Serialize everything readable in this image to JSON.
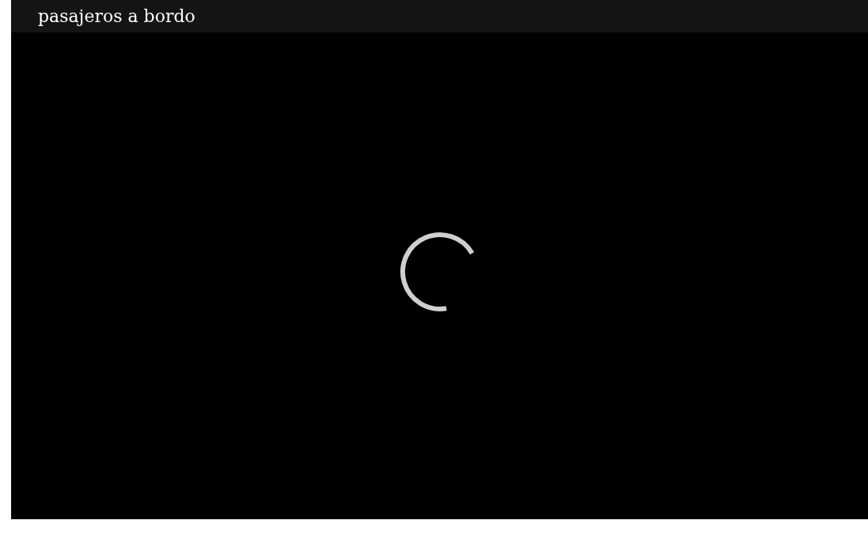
{
  "player": {
    "title": "pasajeros a bordo",
    "loading": true
  }
}
